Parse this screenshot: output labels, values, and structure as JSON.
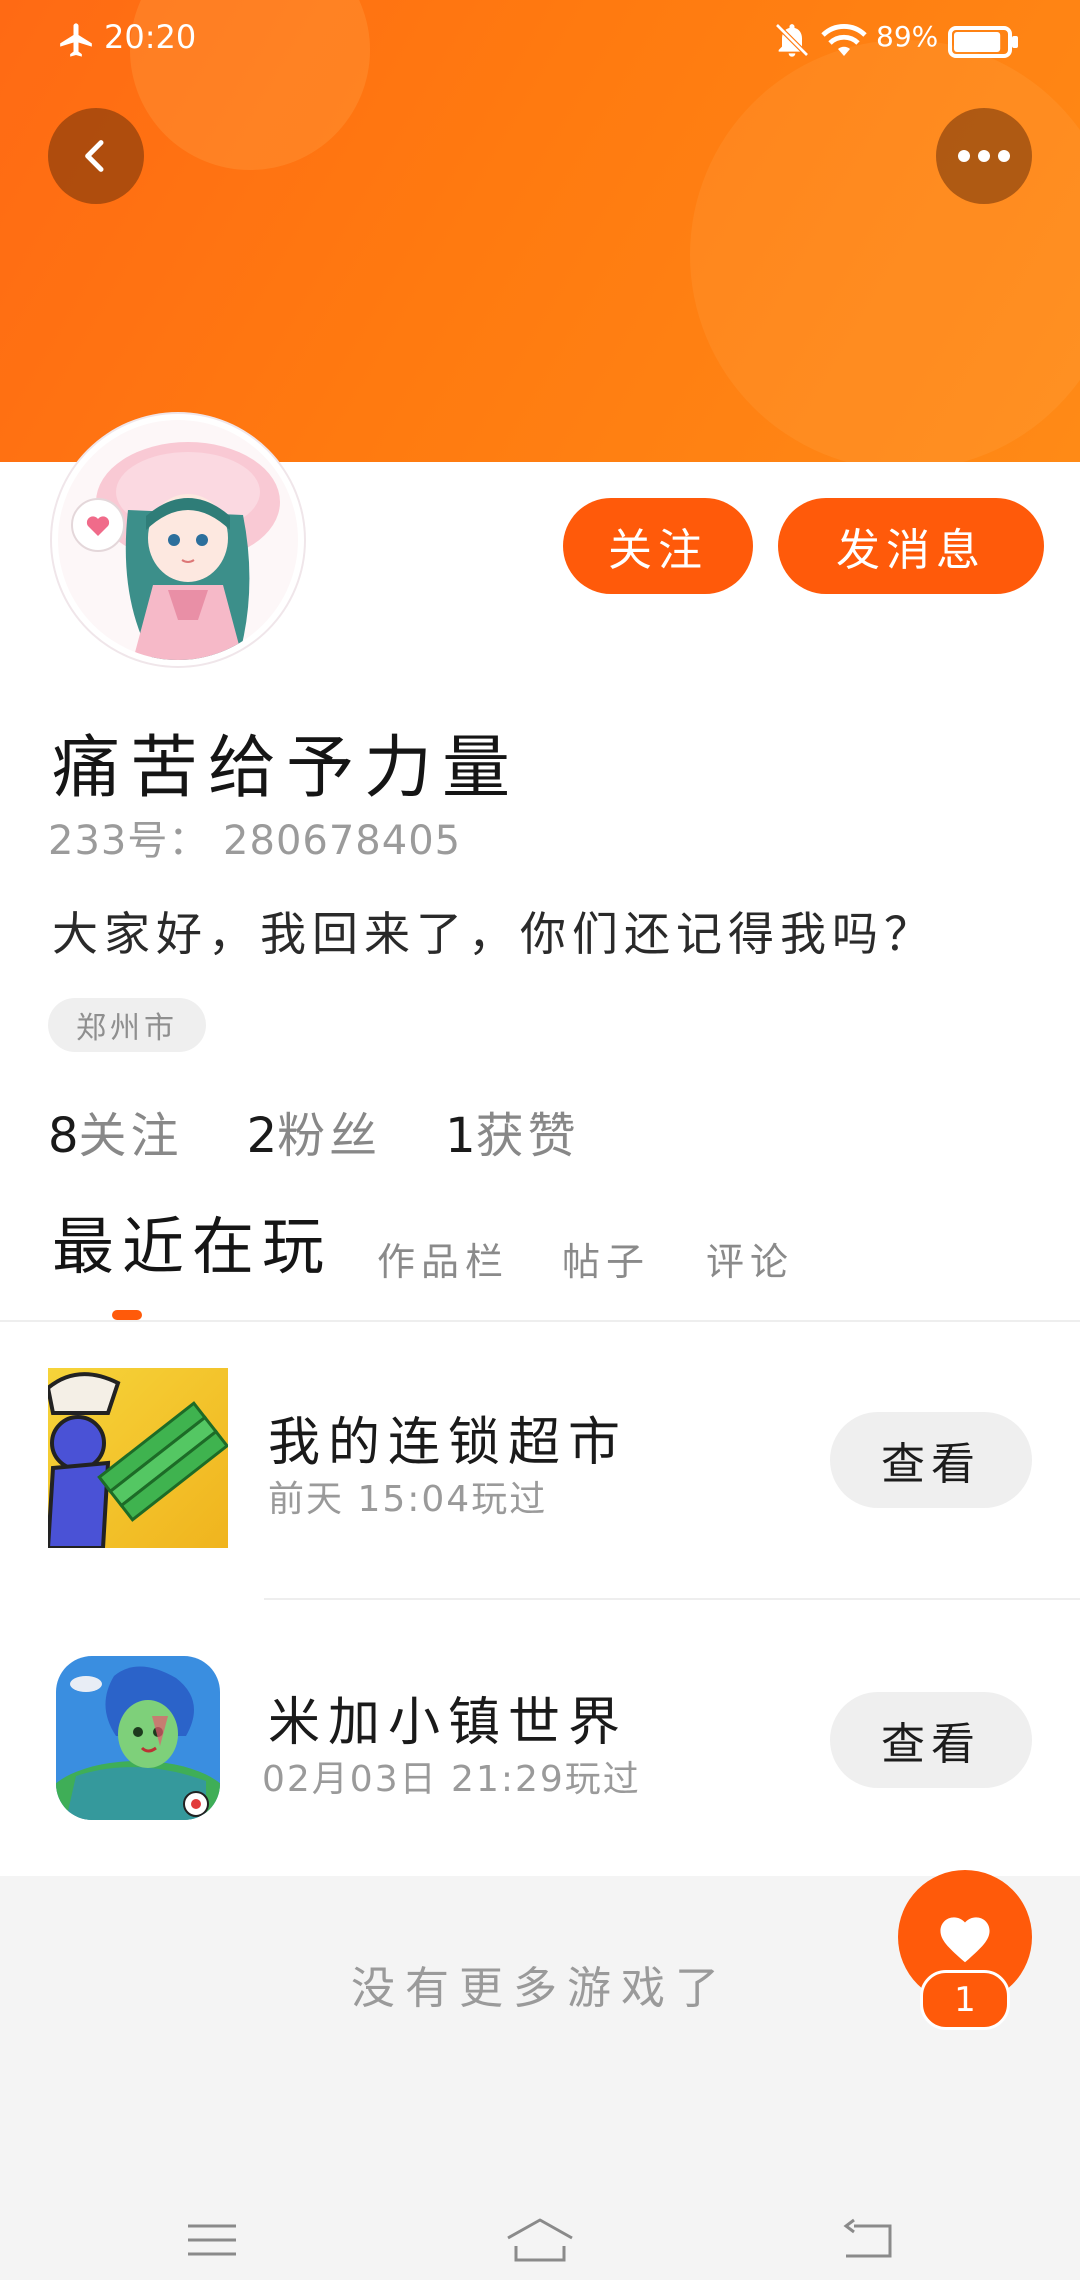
{
  "status_bar": {
    "time": "20:20",
    "battery_text": "89%",
    "battery_level": 0.89,
    "icons": [
      "airplane-icon",
      "bell-off-icon",
      "wifi-icon",
      "battery-icon"
    ]
  },
  "header": {
    "back_icon": "chevron-left-icon",
    "more_icon": "more-dots-icon",
    "banner_color": "#ff7a10"
  },
  "profile": {
    "username": "痛苦给予力量",
    "id_text": "233号： 280678405",
    "bio": "大家好，我回来了，你们还记得我吗？",
    "location": "郑州市",
    "stats": [
      {
        "num": "8",
        "label": "关注"
      },
      {
        "num": "2",
        "label": "粉丝"
      },
      {
        "num": "1",
        "label": "获赞"
      }
    ]
  },
  "actions": {
    "follow_label": "关注",
    "message_label": "发消息",
    "accent_color": "#ff5a0a"
  },
  "tabs": [
    {
      "label": "最近在玩",
      "active": true
    },
    {
      "label": "作品栏",
      "active": false
    },
    {
      "label": "帖子",
      "active": false
    },
    {
      "label": "评论",
      "active": false
    }
  ],
  "games": [
    {
      "title": "我的连锁超市",
      "played": "前天 15:04玩过",
      "button": "查看"
    },
    {
      "title": "米加小镇世界",
      "played": "02月03日 21:29玩过",
      "button": "查看"
    }
  ],
  "footer": {
    "no_more_text": "没有更多游戏了",
    "like_count": "1"
  },
  "nav_bar": {
    "icons": [
      "menu-icon",
      "home-icon",
      "back-icon"
    ]
  }
}
